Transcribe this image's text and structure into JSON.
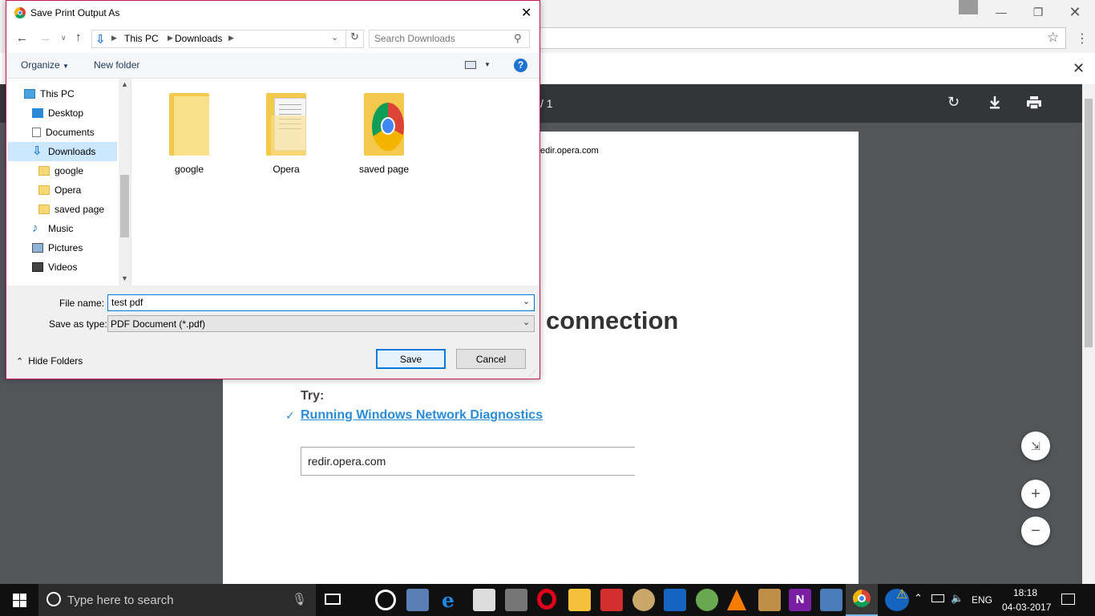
{
  "dialog": {
    "title": "Save Print Output As",
    "breadcrumb": [
      "This PC",
      "Downloads"
    ],
    "search_placeholder": "Search Downloads",
    "organize_label": "Organize",
    "new_folder_label": "New folder",
    "nav_items": [
      {
        "label": "This PC",
        "icon": "computer-icon"
      },
      {
        "label": "Desktop",
        "icon": "desktop-icon"
      },
      {
        "label": "Documents",
        "icon": "documents-icon"
      },
      {
        "label": "Downloads",
        "icon": "downloads-icon",
        "selected": true
      },
      {
        "label": "google",
        "icon": "folder-icon"
      },
      {
        "label": "Opera",
        "icon": "folder-icon"
      },
      {
        "label": "saved page",
        "icon": "folder-icon"
      },
      {
        "label": "Music",
        "icon": "music-icon"
      },
      {
        "label": "Pictures",
        "icon": "pictures-icon"
      },
      {
        "label": "Videos",
        "icon": "videos-icon"
      }
    ],
    "folders": [
      {
        "label": "google"
      },
      {
        "label": "Opera"
      },
      {
        "label": "saved page"
      }
    ],
    "file_name_label": "File name:",
    "file_name_value": "test pdf",
    "save_type_label": "Save as type:",
    "save_type_value": "PDF Document (*.pdf)",
    "hide_folders_label": "Hide Folders",
    "save_label": "Save",
    "cancel_label": "Cancel"
  },
  "pdf": {
    "page_indicator": "/ 1",
    "header_url": "edir.opera.com",
    "heading_fragment": "connection",
    "try_label": "Try:",
    "link_text": "Running Windows Network Diagnostics",
    "url_box_text": "redir.opera.com"
  },
  "taskbar": {
    "search_placeholder": "Type here to search",
    "language": "ENG",
    "time": "18:18",
    "date": "04-03-2017"
  },
  "colors": {
    "accent": "#0078d7",
    "dialog_border": "#c2185b",
    "link": "#2a8cd8",
    "pdf_toolbar": "#323639"
  }
}
